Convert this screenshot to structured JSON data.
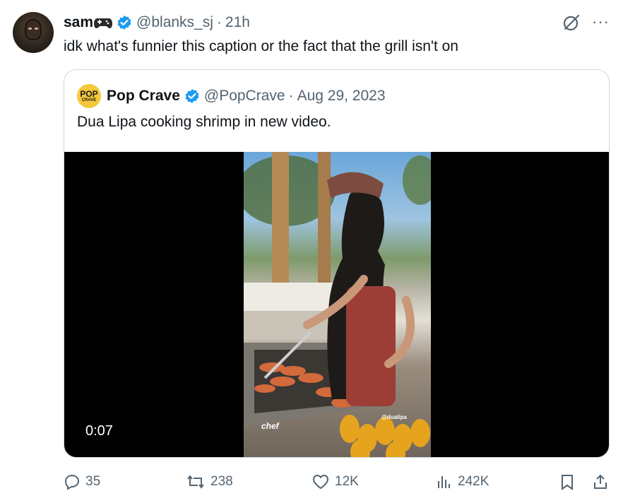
{
  "tweet": {
    "name": "sam",
    "handle": "@blanks_sj",
    "separator": "·",
    "time": "21h",
    "text": "idk what's funnier this caption or the fact that the grill isn't on"
  },
  "quote": {
    "name": "Pop Crave",
    "logo_line1": "POP",
    "logo_line2": "CRAVE",
    "handle": "@PopCrave",
    "separator": "·",
    "date": "Aug 29, 2023",
    "text": "Dua Lipa cooking shrimp in new video.",
    "video_duration": "0:07",
    "video_caption": "chef",
    "video_tag": "@dualipa"
  },
  "actions": {
    "replies": "35",
    "reposts": "238",
    "likes": "12K",
    "views": "242K"
  },
  "colors": {
    "verified": "#1d9bf0",
    "muted": "#536471",
    "border": "#cfd9de"
  },
  "icons": [
    "gamepad-icon",
    "verified-icon",
    "grok-icon",
    "more-icon",
    "reply-icon",
    "repost-icon",
    "like-icon",
    "views-icon",
    "bookmark-icon",
    "share-icon"
  ]
}
